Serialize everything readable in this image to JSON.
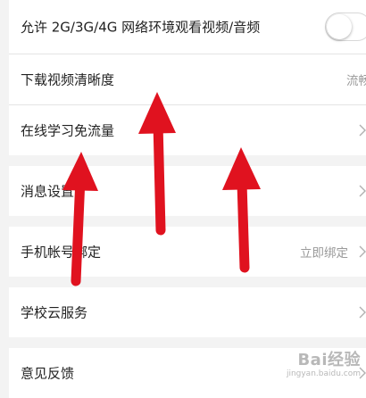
{
  "settings": {
    "mobile_network_label": "允许 2G/3G/4G 网络环境观看视频/音频",
    "download_quality_label": "下载视频清晰度",
    "download_quality_value": "流畅",
    "free_traffic_label": "在线学习免流量",
    "notifications_label": "消息设置",
    "phone_binding_label": "手机帐号绑定",
    "phone_binding_value": "立即绑定",
    "school_cloud_label": "学校云服务",
    "feedback_label": "意见反馈"
  },
  "watermark": {
    "brand": "Bai经验",
    "url": "jingyan.baidu.com"
  },
  "colors": {
    "arrow": "#e0121f",
    "background": "#f3f3f3",
    "row": "#ffffff"
  }
}
